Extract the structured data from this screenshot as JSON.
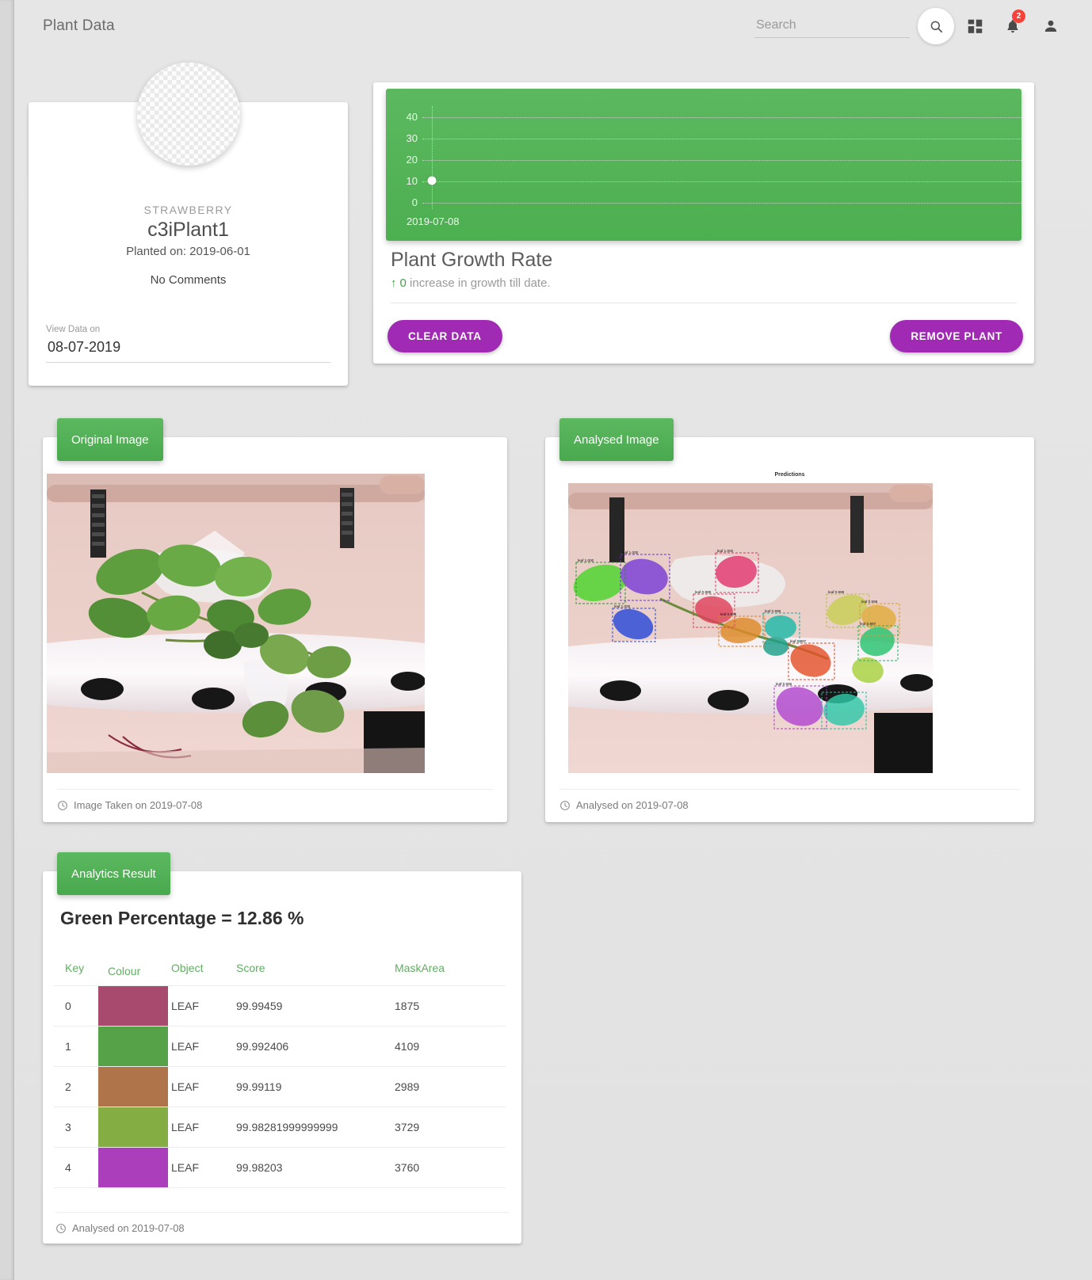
{
  "topbar": {
    "title": "Plant Data",
    "search_placeholder": "Search",
    "search_value": "",
    "notification_count": "2"
  },
  "profile": {
    "species": "STRAWBERRY",
    "name": "c3iPlant1",
    "planted_on": "Planted on: 2019-06-01",
    "comments": "No Comments",
    "date_label": "View Data on",
    "date_value": "08-07-2019"
  },
  "growth": {
    "title": "Plant Growth Rate",
    "subtitle_arrow": "↑",
    "subtitle_value": "0",
    "subtitle_text": "increase in growth till date.",
    "clear_button": "CLEAR DATA",
    "remove_button": "REMOVE PLANT",
    "accent_purple": "#a02ab3",
    "accent_green": "#4caf50"
  },
  "chart_data": {
    "type": "scatter",
    "title": "Plant Growth Rate",
    "x": [
      "2019-07-08"
    ],
    "values": [
      10.5
    ],
    "categories": [
      "2019-07-08"
    ],
    "yticks": [
      40,
      30,
      20,
      10,
      0
    ],
    "ylim": [
      0,
      45
    ],
    "xlabel": "",
    "ylabel": "",
    "grid": true,
    "legend": "none",
    "point_color": "#ffffff",
    "background_color": "#4caf50"
  },
  "original_image_card": {
    "header": "Original Image",
    "footer": "Image Taken on 2019-07-08"
  },
  "analysed_image_card": {
    "header": "Analysed Image",
    "footer": "Analysed on 2019-07-08",
    "plot_title": "Predictions",
    "box_labels": [
      "leaf 1.000",
      "leaf 1.000",
      "leaf 1.000",
      "leaf 1.000",
      "leaf 0.999",
      "leaf 0.999",
      "leaf 0.998",
      "leaf 0.998"
    ]
  },
  "analytics": {
    "header": "Analytics Result",
    "green_percentage": "Green Percentage = 12.86 %",
    "footer": "Analysed on 2019-07-08",
    "columns": [
      "Key",
      "Colour",
      "Object",
      "Score",
      "MaskArea"
    ],
    "rows": [
      {
        "key": "0",
        "colour": "#a84a6e",
        "object": "LEAF",
        "score": "99.99459",
        "maskarea": "1875"
      },
      {
        "key": "1",
        "colour": "#55a248",
        "object": "LEAF",
        "score": "99.992406",
        "maskarea": "4109"
      },
      {
        "key": "2",
        "colour": "#b0744a",
        "object": "LEAF",
        "score": "99.99119",
        "maskarea": "2989"
      },
      {
        "key": "3",
        "colour": "#84ad44",
        "object": "LEAF",
        "score": "99.98281999999999",
        "maskarea": "3729"
      },
      {
        "key": "4",
        "colour": "#ab3fbb",
        "object": "LEAF",
        "score": "99.98203",
        "maskarea": "3760"
      }
    ]
  }
}
